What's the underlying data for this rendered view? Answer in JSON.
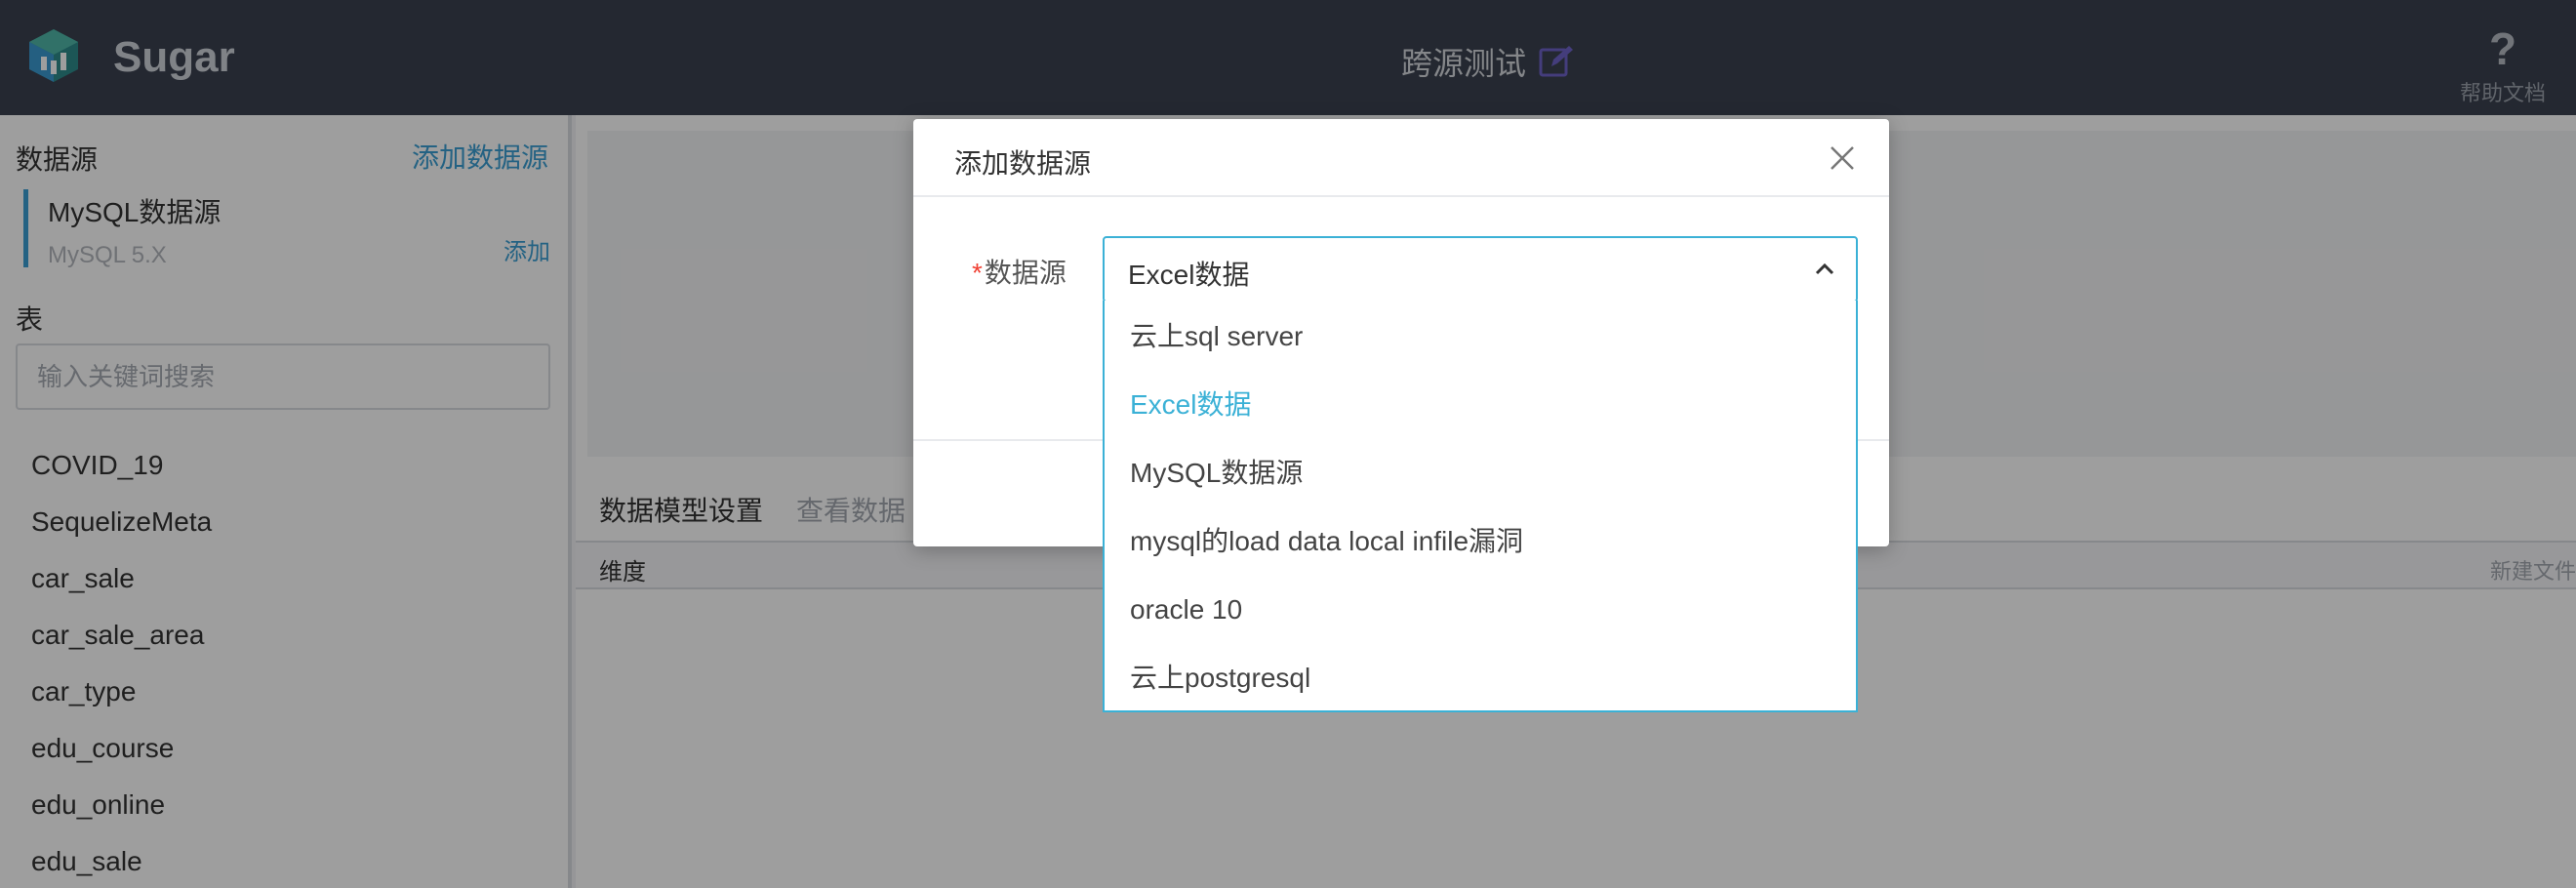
{
  "header": {
    "brand": "Sugar",
    "page_title": "跨源测试",
    "help_label": "帮助文档",
    "help_glyph": "?"
  },
  "sidebar": {
    "datasource_label": "数据源",
    "add_datasource": "添加数据源",
    "datasource": {
      "name": "MySQL数据源",
      "version": "MySQL 5.X",
      "add": "添加"
    },
    "table_label": "表",
    "search_placeholder": "输入关键词搜索",
    "tables": [
      "COVID_19",
      "SequelizeMeta",
      "car_sale",
      "car_sale_area",
      "car_type",
      "edu_course",
      "edu_online",
      "edu_sale"
    ]
  },
  "main": {
    "tabs": [
      "数据模型设置",
      "查看数据"
    ],
    "dimension_header": "维度",
    "new_folder": "新建文件"
  },
  "modal": {
    "title": "添加数据源",
    "field_label": "数据源",
    "required_mark": "*",
    "selected_value": "Excel数据",
    "options": [
      "云上sql server",
      "Excel数据",
      "MySQL数据源",
      "mysql的load data local infile漏洞",
      "oracle 10",
      "云上postgresql"
    ],
    "active_option_index": 1
  },
  "colors": {
    "header_bg": "#3a4150",
    "accent": "#3b9fd3",
    "select_focus": "#3bb1d6",
    "primary_button": "#5b5fc7",
    "required": "#f04134"
  }
}
